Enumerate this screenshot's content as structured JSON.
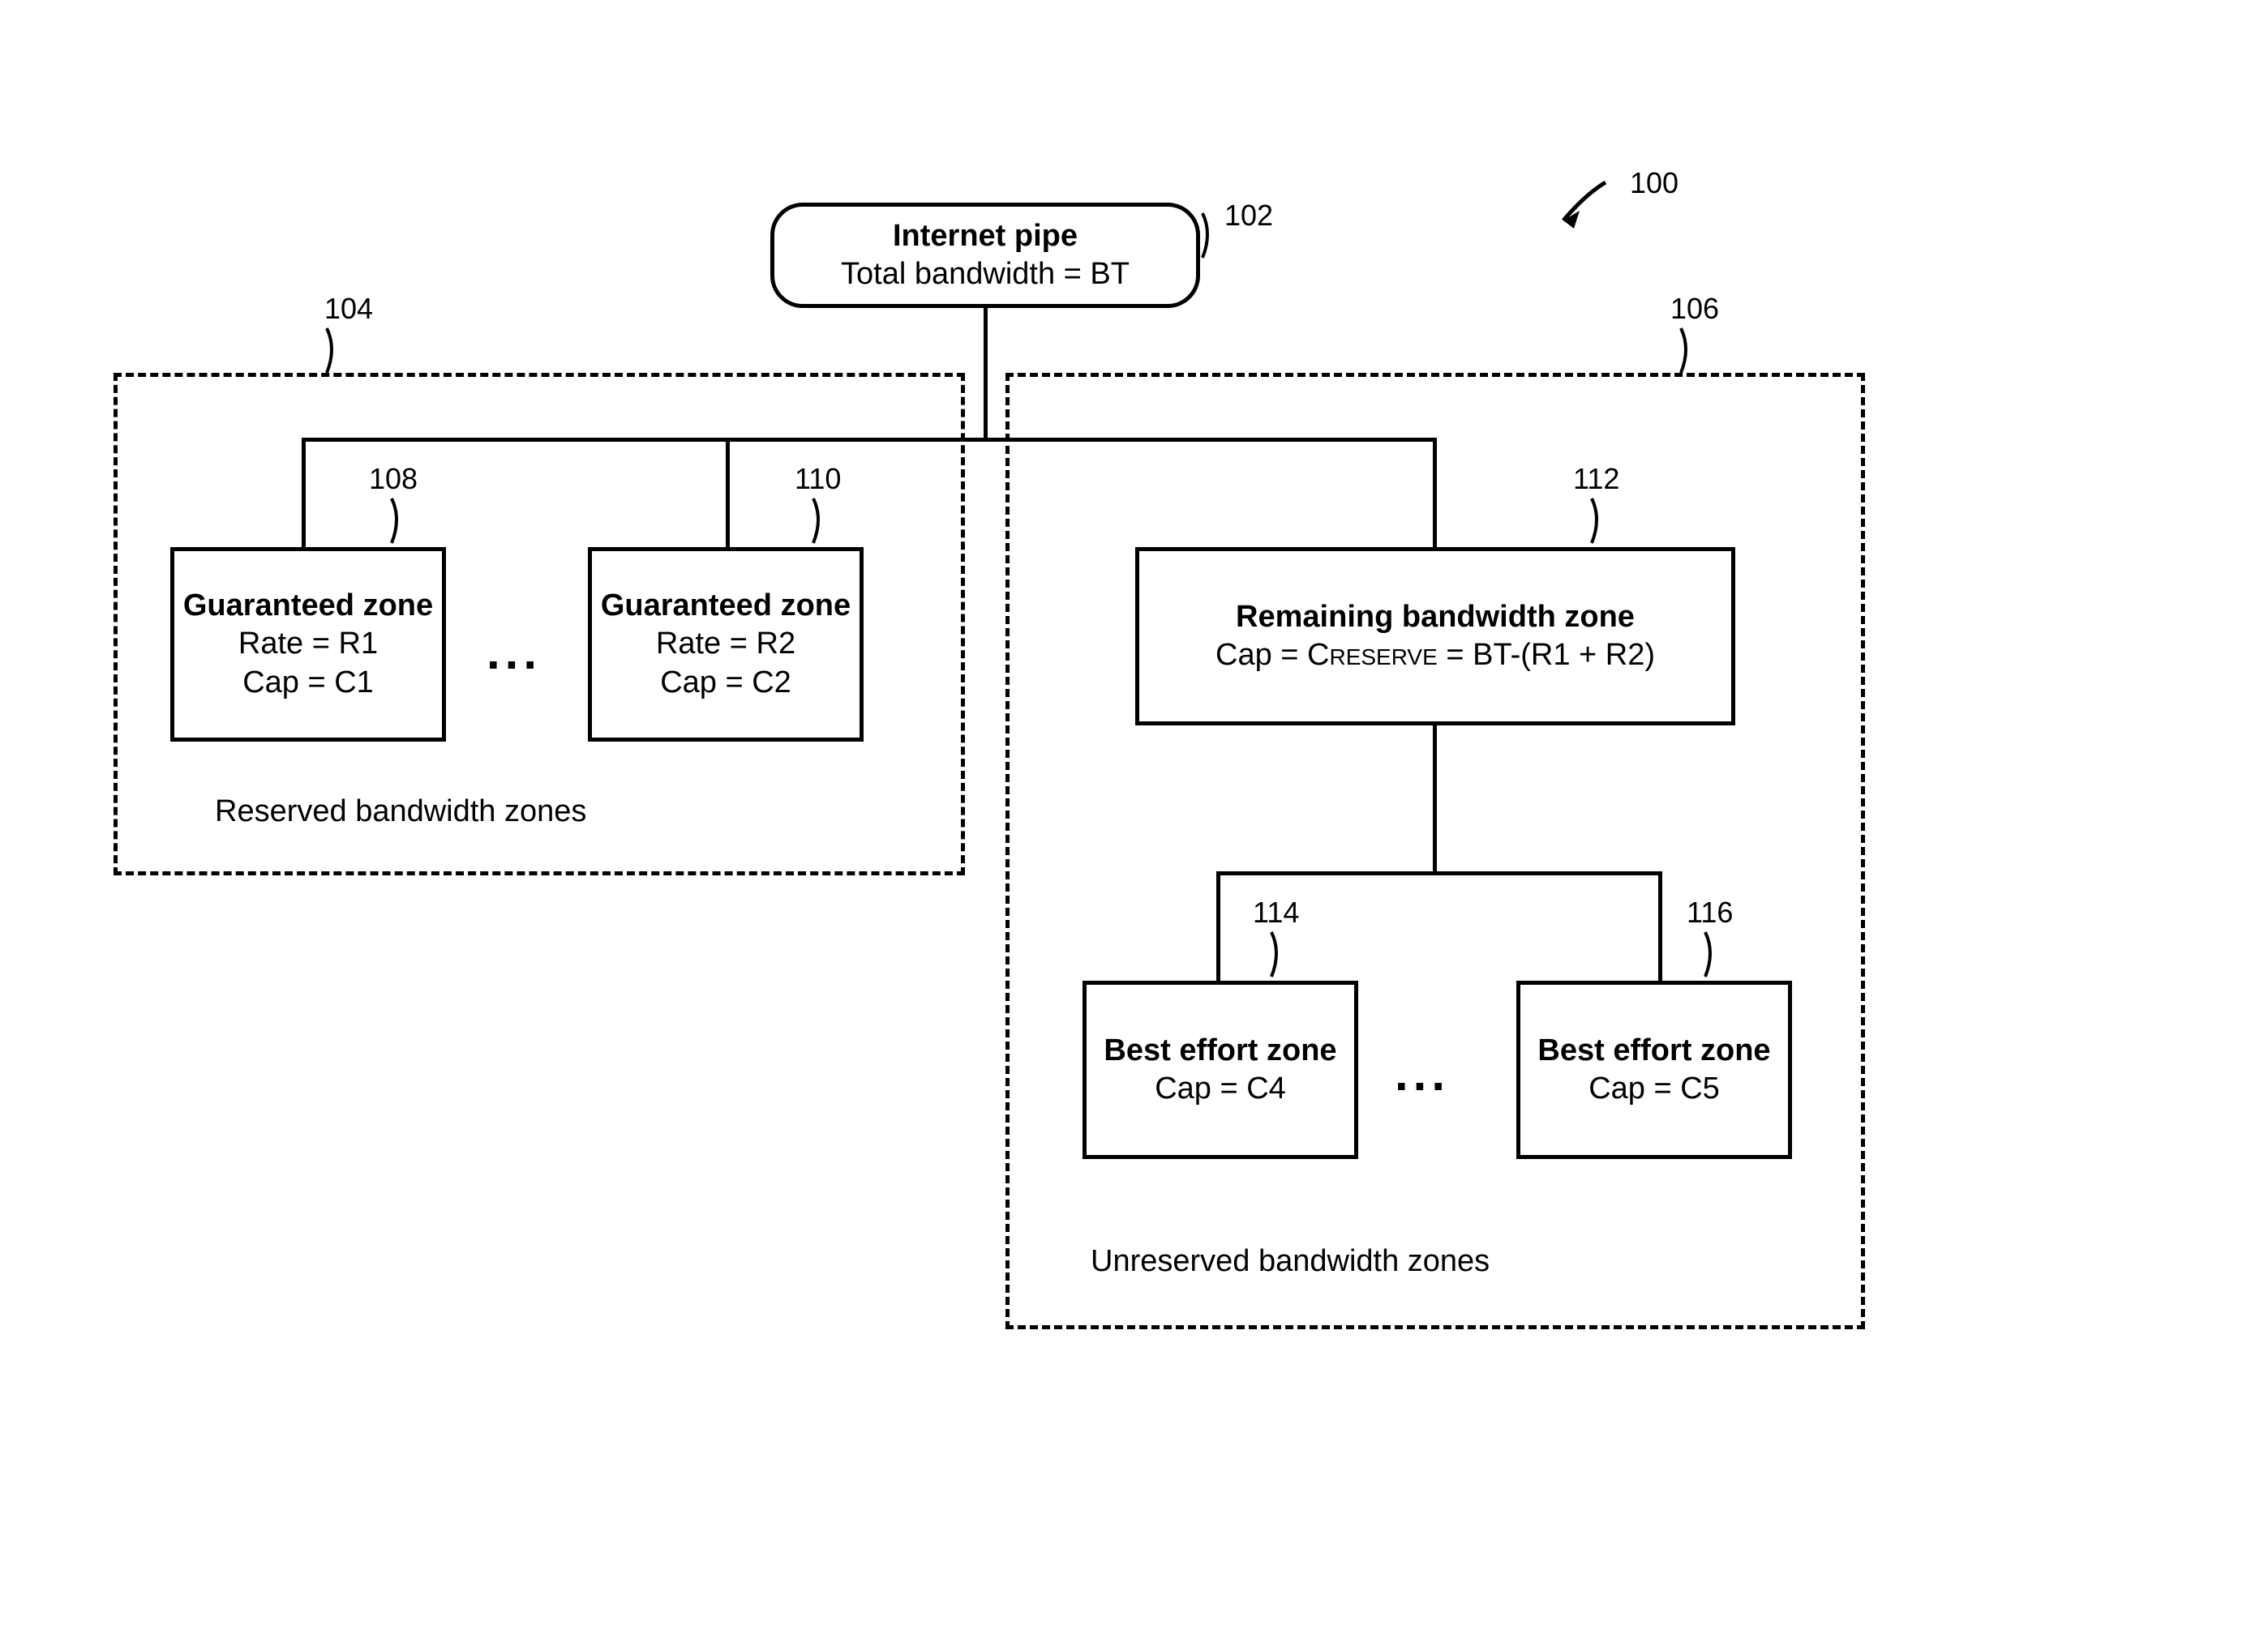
{
  "refs": {
    "fig": "100",
    "root": "102",
    "reserved_group": "104",
    "unreserved_group": "106",
    "gz1": "108",
    "gz2": "110",
    "remaining": "112",
    "be1": "114",
    "be2": "116"
  },
  "root": {
    "title": "Internet pipe",
    "sub": "Total bandwidth = BT"
  },
  "reserved": {
    "caption": "Reserved bandwidth zones",
    "gz1": {
      "title": "Guaranteed zone",
      "rate": "Rate = R1",
      "cap": "Cap = C1"
    },
    "gz2": {
      "title": "Guaranteed zone",
      "rate": "Rate = R2",
      "cap": "Cap = C2"
    },
    "ellipsis": "..."
  },
  "unreserved": {
    "caption": "Unreserved bandwidth zones",
    "remaining": {
      "title": "Remaining bandwidth zone",
      "cap_pre": "Cap = C",
      "cap_small": "RESERVE",
      "cap_post": " = BT-(R1 + R2)"
    },
    "be1": {
      "title": "Best effort zone",
      "cap": "Cap = C4"
    },
    "be2": {
      "title": "Best effort zone",
      "cap": "Cap = C5"
    },
    "ellipsis": "..."
  }
}
